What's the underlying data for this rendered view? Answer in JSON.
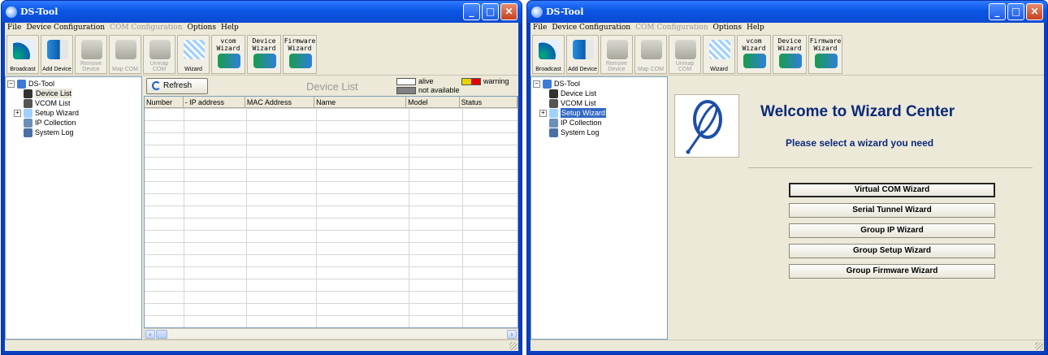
{
  "windows": [
    {
      "title": "DS-Tool",
      "menu": [
        {
          "label": "File",
          "enabled": true
        },
        {
          "label": "Device Configuration",
          "enabled": true
        },
        {
          "label": "COM Configuration",
          "enabled": false
        },
        {
          "label": "Options",
          "enabled": true
        },
        {
          "label": "Help",
          "enabled": true
        }
      ],
      "toolbar": [
        {
          "label": "Broadcast",
          "icon": "broadcast-icon",
          "enabled": true
        },
        {
          "label": "Add Device",
          "icon": "add-device-icon",
          "enabled": true
        },
        {
          "label": "Remove Device",
          "icon": "remove-device-icon",
          "enabled": false
        },
        {
          "label": "Map COM",
          "icon": "map-com-icon",
          "enabled": false
        },
        {
          "label": "Unmap COM",
          "icon": "unmap-com-icon",
          "enabled": false
        },
        {
          "label": "Wizard",
          "icon": "wizard-icon",
          "enabled": true
        },
        {
          "label": "vcom Wizard",
          "icon": "vcom-wizard-icon",
          "enabled": true
        },
        {
          "label": "Device Wizard",
          "icon": "device-wizard-icon",
          "enabled": true
        },
        {
          "label": "Firmware Wizard",
          "icon": "firmware-wizard-icon",
          "enabled": true
        }
      ],
      "tree": {
        "root": "DS-Tool",
        "items": [
          "Device List",
          "VCOM List",
          "Setup Wizard",
          "IP Collection",
          "System Log"
        ]
      },
      "device_list": {
        "refresh_label": "Refresh",
        "title": "Device List",
        "legend": [
          {
            "label": "alive",
            "color": "#ffffff"
          },
          {
            "label": "warning",
            "color": "#ff0000"
          },
          {
            "label": "not available",
            "color": "#808080"
          }
        ],
        "columns": [
          "Number",
          "- IP address",
          "MAC Address",
          "Name",
          "Model",
          "Status"
        ]
      }
    },
    {
      "title": "DS-Tool",
      "menu": [
        {
          "label": "File",
          "enabled": true
        },
        {
          "label": "Device Configuration",
          "enabled": true
        },
        {
          "label": "COM Configuration",
          "enabled": false
        },
        {
          "label": "Options",
          "enabled": true
        },
        {
          "label": "Help",
          "enabled": true
        }
      ],
      "toolbar": [
        {
          "label": "Broadcast",
          "icon": "broadcast-icon",
          "enabled": true
        },
        {
          "label": "Add Device",
          "icon": "add-device-icon",
          "enabled": true
        },
        {
          "label": "Remove Device",
          "icon": "remove-device-icon",
          "enabled": false
        },
        {
          "label": "Map COM",
          "icon": "map-com-icon",
          "enabled": false
        },
        {
          "label": "Unmap COM",
          "icon": "unmap-com-icon",
          "enabled": false
        },
        {
          "label": "Wizard",
          "icon": "wizard-icon",
          "enabled": true
        },
        {
          "label": "vcom Wizard",
          "icon": "vcom-wizard-icon",
          "enabled": true
        },
        {
          "label": "Device Wizard",
          "icon": "device-wizard-icon",
          "enabled": true
        },
        {
          "label": "Firmware Wizard",
          "icon": "firmware-wizard-icon",
          "enabled": true
        }
      ],
      "tree": {
        "root": "DS-Tool",
        "items": [
          "Device List",
          "VCOM List",
          "Setup Wizard",
          "IP Collection",
          "System Log"
        ]
      },
      "wizard_center": {
        "title": "Welcome to Wizard Center",
        "subtitle": "Please select a wizard you need",
        "buttons": [
          "Virtual COM Wizard",
          "Serial Tunnel Wizard",
          "Group IP Wizard",
          "Group Setup Wizard",
          "Group Firmware Wizard"
        ]
      }
    }
  ]
}
